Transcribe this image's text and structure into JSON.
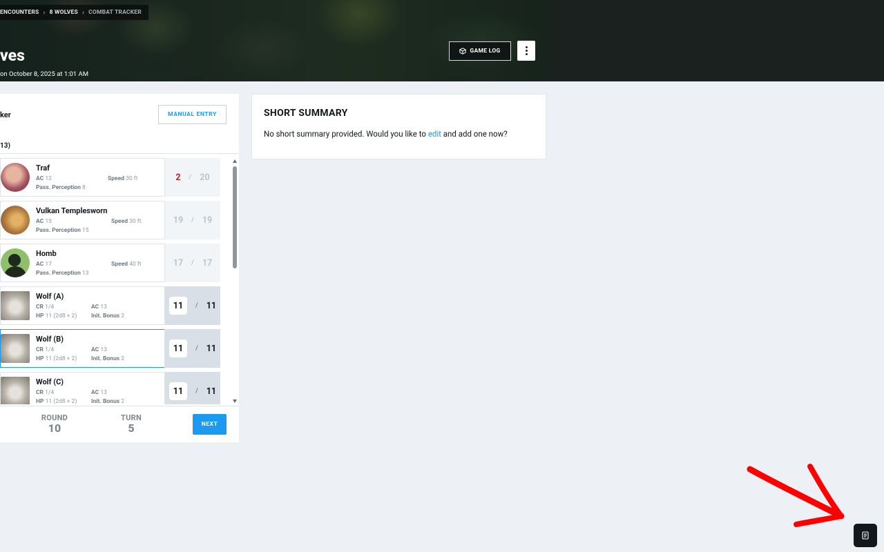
{
  "breadcrumb": {
    "items": [
      "ENCOUNTERS",
      "8 WOLVES"
    ],
    "current": "COMBAT TRACKER"
  },
  "header": {
    "title": "ves",
    "subtitle": "on October 8, 2025 at 1:01 AM",
    "game_log_label": "GAME LOG"
  },
  "tracker": {
    "title": "ker",
    "manual_entry_label": "MANUAL ENTRY",
    "count_label": "13)",
    "combatants": [
      {
        "name": "Traf",
        "kind": "player",
        "ac_label": "AC",
        "ac": "12",
        "speed_label": "Speed",
        "speed": "30 ft",
        "perc_label": "Pass. Perception",
        "perc": "8",
        "hp_current": "2",
        "hp_max": "20",
        "hp_fraction": 0.1
      },
      {
        "name": "Vulkan Templesworn",
        "kind": "player",
        "ac_label": "AC",
        "ac": "15",
        "speed_label": "Speed",
        "speed": "30 ft",
        "perc_label": "Pass. Perception",
        "perc": "15",
        "hp_current": "19",
        "hp_max": "19"
      },
      {
        "name": "Homb",
        "kind": "player",
        "ac_label": "AC",
        "ac": "17",
        "speed_label": "Speed",
        "speed": "40 ft",
        "perc_label": "Pass. Perception",
        "perc": "13",
        "hp_current": "17",
        "hp_max": "17"
      },
      {
        "name": "Wolf (A)",
        "kind": "monster",
        "cr_label": "CR",
        "cr": "1/4",
        "ac_label": "AC",
        "ac": "13",
        "hp_label": "HP",
        "hp_formula": "11 (2d8 + 2)",
        "init_label": "Init. Bonus",
        "init": "2",
        "hp_current": "11",
        "hp_max": "11"
      },
      {
        "name": "Wolf (B)",
        "kind": "monster",
        "active": true,
        "cr_label": "CR",
        "cr": "1/4",
        "ac_label": "AC",
        "ac": "13",
        "hp_label": "HP",
        "hp_formula": "11 (2d8 + 2)",
        "init_label": "Init. Bonus",
        "init": "2",
        "hp_current": "11",
        "hp_max": "11"
      },
      {
        "name": "Wolf (C)",
        "kind": "monster",
        "cr_label": "CR",
        "cr": "1/4",
        "ac_label": "AC",
        "ac": "13",
        "hp_label": "HP",
        "hp_formula": "11 (2d8 + 2)",
        "init_label": "Init. Bonus",
        "init": "2",
        "hp_current": "11",
        "hp_max": "11"
      }
    ],
    "round_label": "ROUND",
    "round_value": "10",
    "turn_label": "TURN",
    "turn_value": "5",
    "next_label": "NEXT"
  },
  "summary": {
    "title": "SHORT SUMMARY",
    "text_before": "No short summary provided. Would you like to ",
    "link": "edit",
    "text_after": " and add one now?"
  },
  "colors": {
    "accent": "#1b9af0",
    "low_hp": "#c81b1b",
    "annotation": "#ff0000"
  }
}
